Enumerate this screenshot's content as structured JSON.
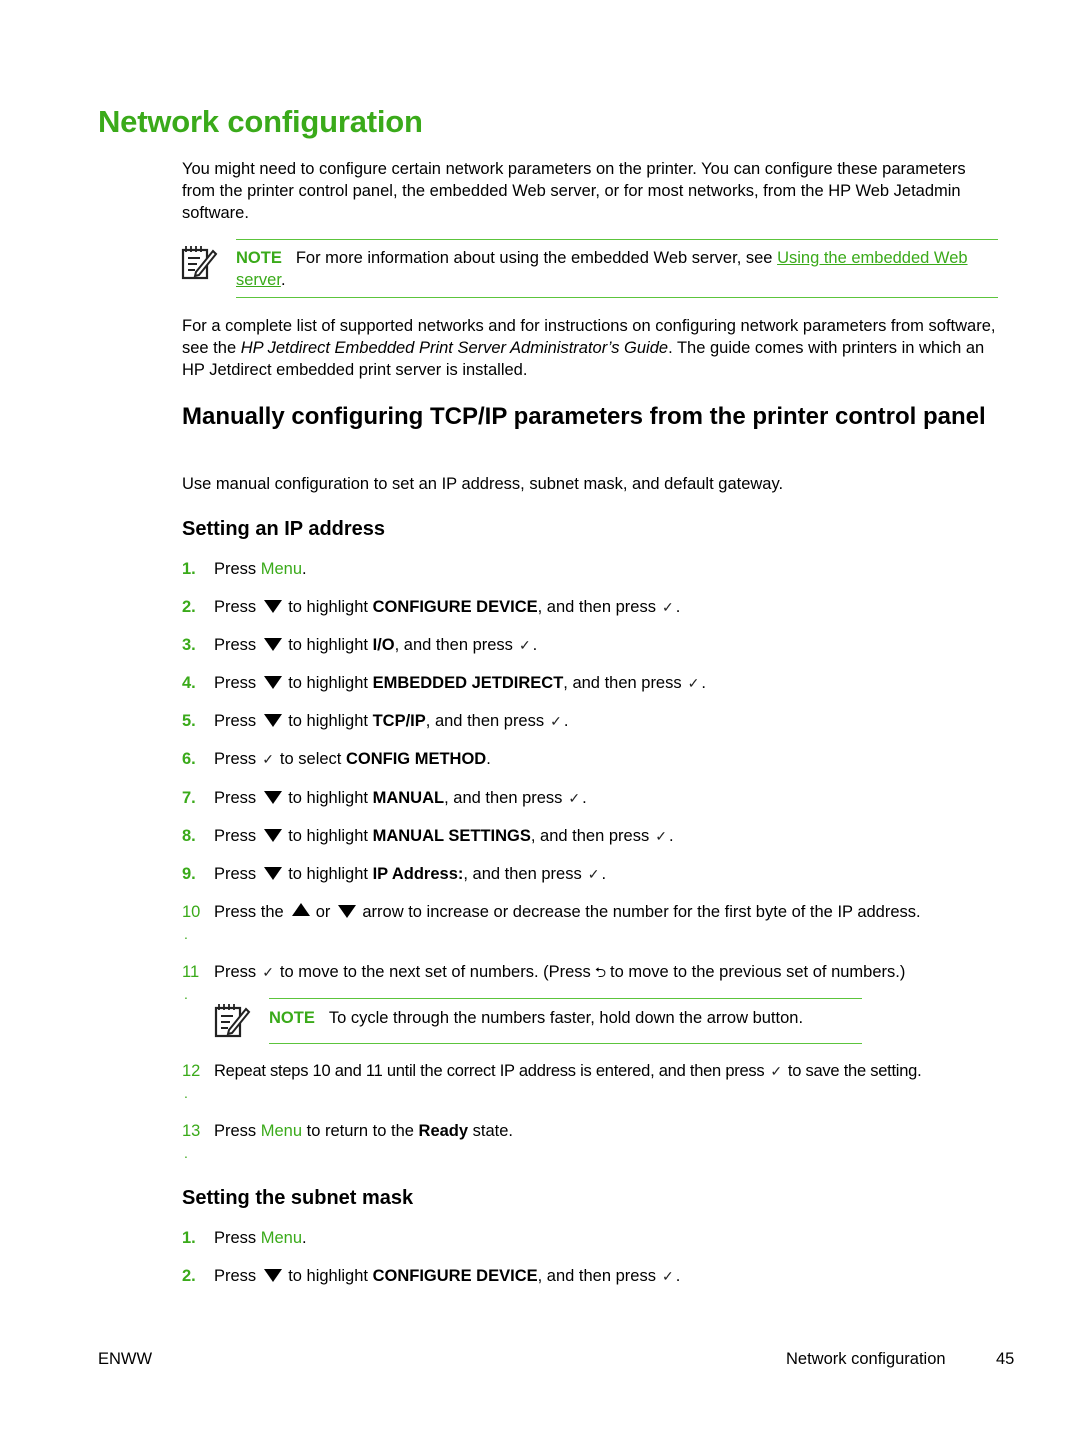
{
  "page_title": "Network configuration",
  "intro": "You might need to configure certain network parameters on the printer. You can configure these parameters from the printer control panel, the embedded Web server, or for most networks, from the HP Web Jetadmin software.",
  "note1": {
    "label": "NOTE",
    "text": "For more information about using the embedded Web server, see ",
    "link": "Using the embedded Web server",
    "after": "."
  },
  "para2": {
    "before": "For a complete list of supported networks and for instructions on configuring network parameters from software, see the ",
    "italic": "HP Jetdirect Embedded Print Server Administrator’s Guide",
    "after": ". The guide comes with printers in which an HP Jetdirect embedded print server is installed."
  },
  "section_heading": "Manually configuring TCP/IP parameters from the printer control panel",
  "section_intro": "Use manual configuration to set an IP address, subnet mask, and default gateway.",
  "ip_section": {
    "heading": "Setting an IP address",
    "steps": [
      {
        "num": "1.",
        "pre": "Press ",
        "menu": "Menu",
        "post": "."
      },
      {
        "num": "2.",
        "pre": "Press",
        "mid": "to highlight ",
        "bold": "CONFIGURE DEVICE",
        "post": ", and then press",
        "end": "."
      },
      {
        "num": "3.",
        "pre": "Press",
        "mid": "to highlight ",
        "bold": "I/O",
        "post": ", and then press",
        "end": "."
      },
      {
        "num": "4.",
        "pre": "Press",
        "mid": "to highlight ",
        "bold": "EMBEDDED JETDIRECT",
        "post": ", and then press",
        "end": "."
      },
      {
        "num": "5.",
        "pre": "Press",
        "mid": "to highlight ",
        "bold": "TCP/IP",
        "post": ", and then press",
        "end": "."
      },
      {
        "num": "6.",
        "pre": "Press",
        "mid": "to select ",
        "bold": "CONFIG METHOD",
        "post": "."
      },
      {
        "num": "7.",
        "pre": "Press",
        "mid": "to highlight ",
        "bold": "MANUAL",
        "post": ", and then press",
        "end": "."
      },
      {
        "num": "8.",
        "pre": "Press",
        "mid": "to highlight ",
        "bold": "MANUAL SETTINGS",
        "post": ", and then press",
        "end": "."
      },
      {
        "num": "9.",
        "pre": "Press",
        "mid": "to highlight ",
        "bold": "IP Address:",
        "post": ", and then press",
        "end": "."
      },
      {
        "num": "10",
        "pre": "Press the",
        "or": "or",
        "post": "arrow to increase or decrease the number for the first byte of the IP address."
      },
      {
        "num": "11",
        "pre": "Press",
        "mid": "to move to the next set of numbers. (Press",
        "post": "to move to the previous set of numbers.)"
      },
      {
        "num": "12",
        "pre": "Repeat steps 10 and 11 until the correct IP address is entered, and then press",
        "post": "to save the setting."
      },
      {
        "num": "13",
        "pre": "Press ",
        "menu": "Menu",
        "mid": " to return to the ",
        "bold": "Ready",
        "post": " state."
      }
    ],
    "note": {
      "label": "NOTE",
      "text": "To cycle through the numbers faster, hold down the arrow button."
    }
  },
  "subnet_section": {
    "heading": "Setting the subnet mask",
    "steps": [
      {
        "num": "1.",
        "pre": "Press ",
        "menu": "Menu",
        "post": "."
      },
      {
        "num": "2.",
        "pre": "Press",
        "mid": "to highlight ",
        "bold": "CONFIGURE DEVICE",
        "post": ", and then press",
        "end": "."
      }
    ]
  },
  "icons": {
    "check": "✓",
    "back": "⮌",
    "dot": "."
  },
  "footer": {
    "left": "ENWW",
    "section": "Network configuration",
    "page": "45"
  },
  "colors": {
    "accent": "#3aaa1a"
  }
}
